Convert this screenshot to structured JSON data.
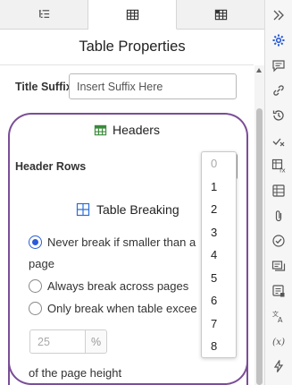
{
  "tabs": [
    {
      "icon": "outline-list-icon"
    },
    {
      "icon": "table-icon",
      "active": true
    },
    {
      "icon": "table-cells-icon"
    }
  ],
  "panel": {
    "title": "Table Properties",
    "title_suffix_label": "Title Suffix",
    "title_suffix_placeholder": "Insert Suffix Here",
    "headers_heading": "Headers",
    "header_rows_label": "Header Rows",
    "header_rows_value": "1",
    "header_rows_options": [
      "0",
      "1",
      "2",
      "3",
      "4",
      "5",
      "6",
      "7",
      "8"
    ],
    "table_breaking_heading": "Table Breaking",
    "break_options": [
      {
        "label": "Never break if smaller than a",
        "checked": true
      },
      {
        "label": "Always break across pages",
        "checked": false
      },
      {
        "label": "Only break when table excee",
        "checked": false
      }
    ],
    "break_option_wrap": "page",
    "percent_placeholder": "25",
    "percent_unit": "%",
    "page_height_text": "of the page height"
  },
  "rail_icons": [
    "double-chevron-right-icon",
    "gear-icon",
    "comment-icon",
    "link-icon",
    "history-icon",
    "track-changes-icon",
    "formula-icon",
    "table-icon",
    "attachment-icon",
    "check-circle-icon",
    "cards-icon",
    "note-icon",
    "translate-icon",
    "variable-icon",
    "lightning-icon"
  ],
  "colors": {
    "accent": "#2a5bd7",
    "highlight_border": "#7a4e97",
    "table_icon_green": "#3a8a3a",
    "table_icon_blue": "#2a6fd6"
  }
}
